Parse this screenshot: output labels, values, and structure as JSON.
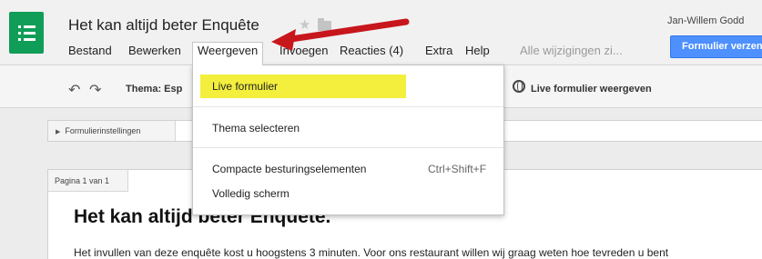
{
  "header": {
    "title": "Het kan altijd beter Enquête",
    "user": "Jan-Willem Godd",
    "save_status": "Alle wijzigingen zi...",
    "send_button": "Formulier verzenden"
  },
  "menu": {
    "items": [
      "Bestand",
      "Bewerken",
      "Weergeven",
      "Invoegen",
      "Reacties (4)",
      "Extra",
      "Help"
    ],
    "active": "Weergeven"
  },
  "toolbar": {
    "theme_label": "Thema: Esp",
    "live_view": "Live formulier weergeven"
  },
  "dropdown": {
    "live_form": "Live formulier",
    "select_theme": "Thema selecteren",
    "compact_controls": "Compacte besturingselementen",
    "compact_shortcut": "Ctrl+Shift+F",
    "fullscreen": "Volledig scherm"
  },
  "settings": {
    "label": "Formulierinstellingen"
  },
  "page": {
    "indicator": "Pagina 1 van 1",
    "form_title": "Het kan altijd beter Enquête.",
    "description": "Het invullen van deze enquête kost u hoogstens 3 minuten. Voor ons restaurant willen wij graag weten hoe tevreden u bent"
  },
  "colors": {
    "brand_green": "#0f9d58",
    "primary_blue": "#4d90fe",
    "highlight_yellow": "#f3ef3c",
    "arrow_red": "#c8161d"
  },
  "icons": [
    "forms-app-icon",
    "star-icon",
    "folder-icon",
    "undo-icon",
    "redo-icon",
    "globe-icon",
    "triangle-right-icon"
  ]
}
